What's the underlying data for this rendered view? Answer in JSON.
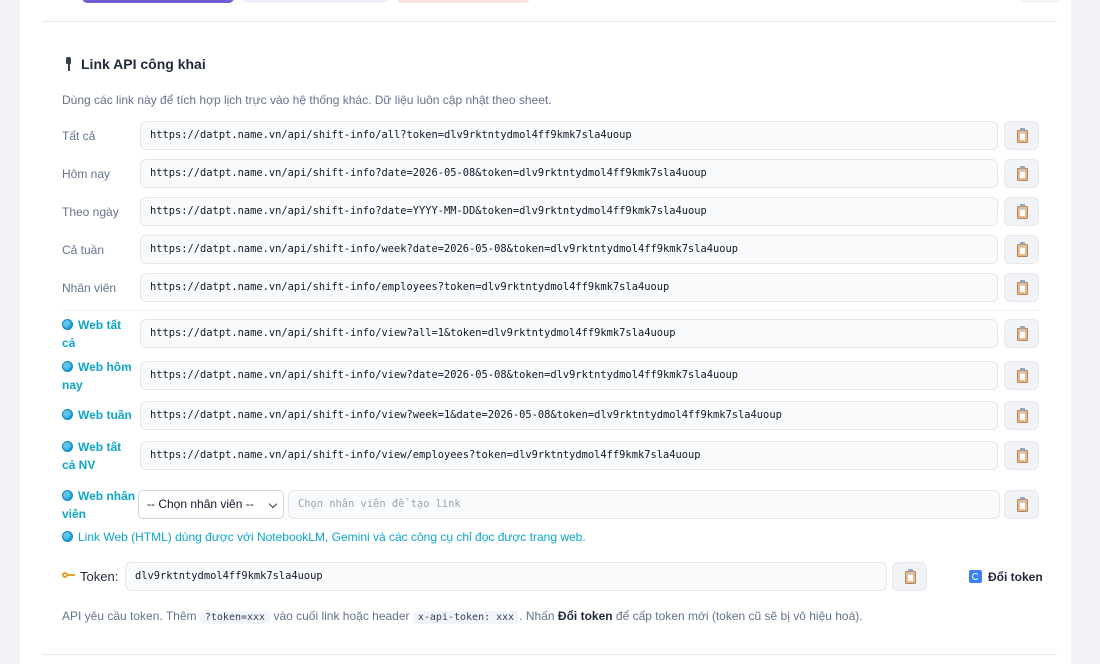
{
  "section": {
    "title": "Link API công khai",
    "title_icon": "pushpin-icon",
    "description": "Dùng các link này để tích hợp lịch trực vào hệ thống khác. Dữ liệu luôn cập nhật theo sheet."
  },
  "links": [
    {
      "label": "Tất cả",
      "url": "https://datpt.name.vn/api/shift-info/all?token=dlv9rktntydmol4ff9kmk7sla4uoup"
    },
    {
      "label": "Hôm nay",
      "url": "https://datpt.name.vn/api/shift-info?date=2026-05-08&token=dlv9rktntydmol4ff9kmk7sla4uoup"
    },
    {
      "label": "Theo ngày",
      "url": "https://datpt.name.vn/api/shift-info?date=YYYY-MM-DD&token=dlv9rktntydmol4ff9kmk7sla4uoup"
    },
    {
      "label": "Cả tuần",
      "url": "https://datpt.name.vn/api/shift-info/week?date=2026-05-08&token=dlv9rktntydmol4ff9kmk7sla4uoup"
    },
    {
      "label": "Nhân viên",
      "url": "https://datpt.name.vn/api/shift-info/employees?token=dlv9rktntydmol4ff9kmk7sla4uoup"
    }
  ],
  "web_links": [
    {
      "label_1": "Web tất",
      "label_2": "cả",
      "url": "https://datpt.name.vn/api/shift-info/view?all=1&token=dlv9rktntydmol4ff9kmk7sla4uoup"
    },
    {
      "label_1": "Web hôm",
      "label_2": "nay",
      "url": "https://datpt.name.vn/api/shift-info/view?date=2026-05-08&token=dlv9rktntydmol4ff9kmk7sla4uoup"
    },
    {
      "label_1": "Web tuần",
      "label_2": "",
      "url": "https://datpt.name.vn/api/shift-info/view?week=1&date=2026-05-08&token=dlv9rktntydmol4ff9kmk7sla4uoup"
    },
    {
      "label_1": "Web tất",
      "label_2": "cả NV",
      "url": "https://datpt.name.vn/api/shift-info/view/employees?token=dlv9rktntydmol4ff9kmk7sla4uoup"
    }
  ],
  "web_employee": {
    "label_1": "Web nhân",
    "label_2": "viên",
    "select_value": "-- Chọn nhân viên --",
    "input_placeholder": "Chọn nhân viên để tạo link"
  },
  "web_note": "Link Web (HTML) dùng được với NotebookLM, Gemini và các công cụ chỉ đọc được trang web.",
  "token": {
    "label": "Token:",
    "value": "dlv9rktntydmol4ff9kmk7sla4uoup",
    "regen_label": "Đổi token"
  },
  "footer": {
    "p1": "API yêu cầu token. Thêm",
    "code1": "?token=xxx",
    "p2": "vào cuối link hoặc header",
    "code2": "x-api-token: xxx",
    "p3": ". Nhấn",
    "bold": "Đổi token",
    "p4": "để cấp token mới (token cũ sẽ bị vô hiệu hoá)."
  },
  "icons": {
    "copy": "clipboard-icon",
    "web": "globe-icon",
    "token": "key-icon",
    "regen": "refresh-icon"
  }
}
